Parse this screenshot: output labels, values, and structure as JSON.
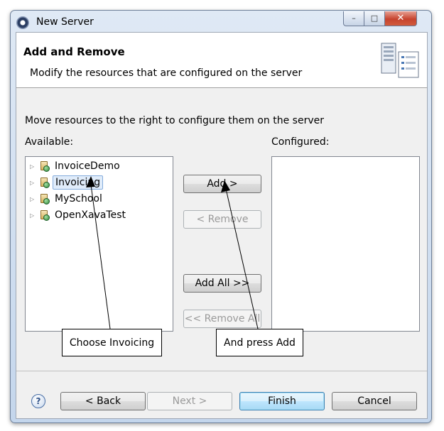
{
  "window": {
    "title": "New Server",
    "controls": {
      "minimize": "–",
      "maximize": "□",
      "close": "✕"
    }
  },
  "header": {
    "title": "Add and Remove",
    "description": "Modify the resources that are configured on the server",
    "icon": "server-config-icon"
  },
  "body": {
    "hint": "Move resources to the right to configure them on the server",
    "available_label": "Available:",
    "configured_label": "Configured:"
  },
  "available": [
    {
      "label": "InvoiceDemo",
      "selected": false
    },
    {
      "label": "Invoicing",
      "selected": true
    },
    {
      "label": "MySchool",
      "selected": false
    },
    {
      "label": "OpenXavaTest",
      "selected": false
    }
  ],
  "configured": [],
  "transfer_buttons": {
    "add": "Add >",
    "remove": "< Remove",
    "add_all": "Add All >>",
    "remove_all": "<< Remove All"
  },
  "callouts": {
    "choose": "Choose Invoicing",
    "press": "And press Add"
  },
  "footer": {
    "help": "?",
    "back": "< Back",
    "next": "Next >",
    "finish": "Finish",
    "cancel": "Cancel"
  }
}
